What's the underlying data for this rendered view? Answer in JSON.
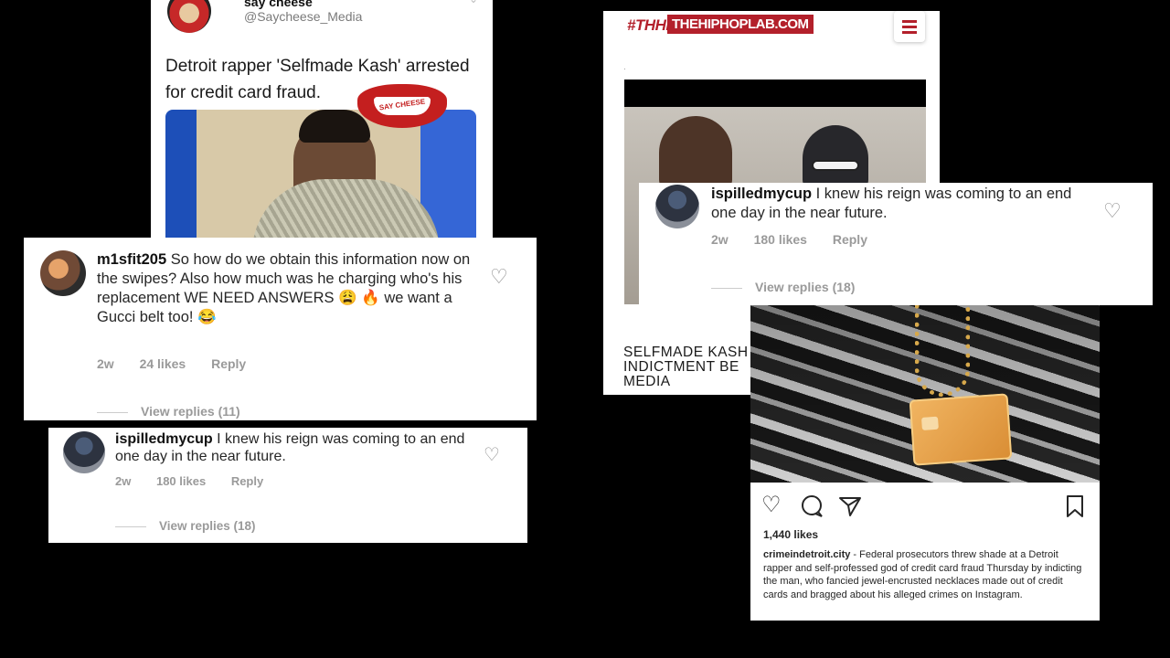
{
  "tweet": {
    "name": "say cheese",
    "handle": "@Saycheese_Media",
    "chevron_icon": "chevron-down-icon",
    "text": "Detroit rapper 'Selfmade Kash' arrested for credit card fraud.",
    "logo_text": "SAY CHEESE"
  },
  "comment_1": {
    "username": "m1sfit205",
    "text": "So how do we obtain this information now on the swipes? Also how much was he charging who's his replacement WE NEED ANSWERS 😩 🔥 we want a Gucci belt too! 😂",
    "age": "2w",
    "likes": "24 likes",
    "reply": "Reply",
    "view_replies": "View replies (11)",
    "heart_icon": "heart-outline-icon"
  },
  "comment_2": {
    "username": "ispilledmycup",
    "text": "I knew his reign was coming to an end one day in the near future.",
    "age": "2w",
    "likes": "180 likes",
    "reply": "Reply",
    "view_replies": "View replies (18)",
    "heart_icon": "heart-outline-icon"
  },
  "comment_3": {
    "username": "ispilledmycup",
    "text": "I knew his reign was coming to an end one day in the near future.",
    "age": "2w",
    "likes": "180 likes",
    "reply": "Reply",
    "view_replies": "View replies (18)",
    "heart_icon": "heart-outline-icon"
  },
  "hiphoplab": {
    "tag": "#THHL",
    "logo": "THEHIPHOPLAB.COM",
    "dot": "·",
    "headline": "SELFMADE KASH INDICTMENT BE MEDIA",
    "headline_lines": [
      "SELFMADE KASH",
      "INDICTMENT BE",
      "MEDIA"
    ],
    "brand_color": "#b3202b",
    "menu_icon": "hamburger-menu-icon"
  },
  "instagram_post": {
    "likes": "1,440 likes",
    "username": "crimeindetroit.city",
    "caption": "- Federal prosecutors threw shade at a Detroit rapper and self-professed god of credit card fraud Thursday by indicting the man, who fancied jewel-encrusted necklaces made out of credit cards and bragged about his alleged crimes on Instagram.",
    "icons": [
      "heart-outline-icon",
      "comment-icon",
      "share-icon",
      "bookmark-icon"
    ]
  }
}
